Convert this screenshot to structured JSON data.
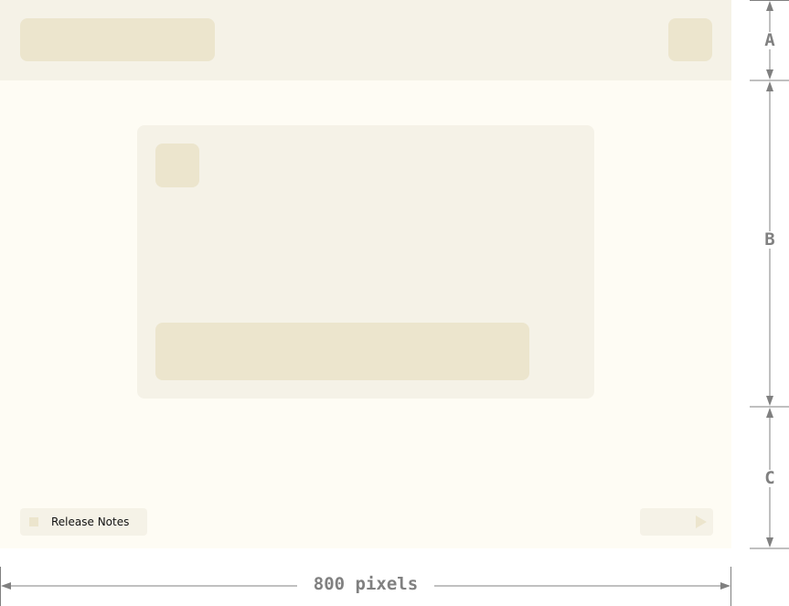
{
  "app": {
    "footer": {
      "release_notes_label": "Release Notes",
      "release_notes_icon": "square-icon",
      "next_icon": "play-icon"
    },
    "colors": {
      "background": "#fefcf4",
      "panel": "#f5f2e7",
      "placeholder": "#ece5cd"
    }
  },
  "dimensions": {
    "header_label": "A",
    "content_label": "B",
    "footer_label": "C",
    "width_label": "800 pixels",
    "line_color": "#808080"
  }
}
